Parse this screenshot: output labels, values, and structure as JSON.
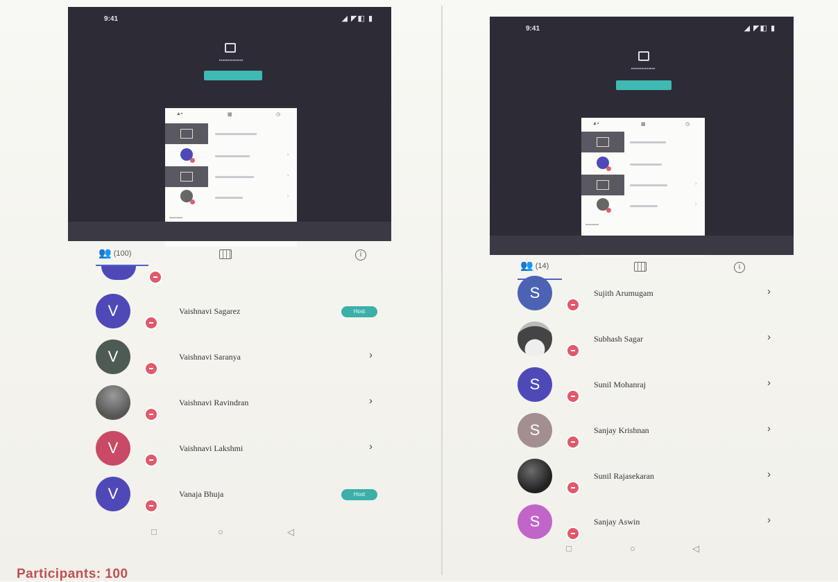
{
  "caption": "Participants: 100",
  "colors": {
    "dark_bg": "#2c2b36",
    "accent_teal": "#3ab0a8",
    "badge_red": "#e05a6c",
    "tab_blue": "#4a63c7"
  },
  "left": {
    "status": {
      "time": "9:41",
      "signal": "◢ ◤◧ ▮"
    },
    "tabs": {
      "people_count": "(100)",
      "grid_icon": "grid-icon",
      "info_icon": "info-icon"
    },
    "participants": [
      {
        "initial": "V",
        "name": "Vaishnavi Sagarez",
        "action": "pill",
        "pill": "Host",
        "avatar_color": "#4f49b8"
      },
      {
        "initial": "V",
        "name": "Vaishnavi Saranya",
        "action": "chevron",
        "avatar_color": "#4e5a54"
      },
      {
        "initial": "",
        "name": "Vaishnavi Ravindran",
        "action": "chevron",
        "avatar_color": "photo-grey"
      },
      {
        "initial": "V",
        "name": "Vaishnavi Lakshmi",
        "action": "chevron",
        "avatar_color": "#c84a66"
      },
      {
        "initial": "V",
        "name": "Vanaja Bhuja",
        "action": "pill",
        "pill": "Host",
        "avatar_color": "#4f49b8"
      }
    ],
    "nav": {
      "back": "◁",
      "home": "○",
      "recent": "□"
    }
  },
  "right": {
    "status": {
      "time": "9:41",
      "signal": "◢ ◤◧ ▮"
    },
    "tabs": {
      "people_count": "(14)",
      "grid_icon": "grid-icon",
      "info_icon": "info-icon"
    },
    "participants": [
      {
        "initial": "S",
        "name": "Sujith Arumugam",
        "action": "chevron",
        "avatar_color": "#4c62b4"
      },
      {
        "initial": "",
        "name": "Subhash Sagar",
        "action": "chevron",
        "avatar_color": "photo-hair"
      },
      {
        "initial": "S",
        "name": "Sunil Mohanraj",
        "action": "chevron",
        "avatar_color": "#4f49b8"
      },
      {
        "initial": "S",
        "name": "Sanjay Krishnan",
        "action": "chevron",
        "avatar_color": "#a38f8f"
      },
      {
        "initial": "",
        "name": "Sunil Rajasekaran",
        "action": "chevron",
        "avatar_color": "photo-dark"
      },
      {
        "initial": "S",
        "name": "Sanjay Aswin",
        "action": "chevron",
        "avatar_color": "#c165c9"
      }
    ],
    "nav": {
      "back": "◁",
      "home": "○",
      "recent": "□"
    }
  }
}
